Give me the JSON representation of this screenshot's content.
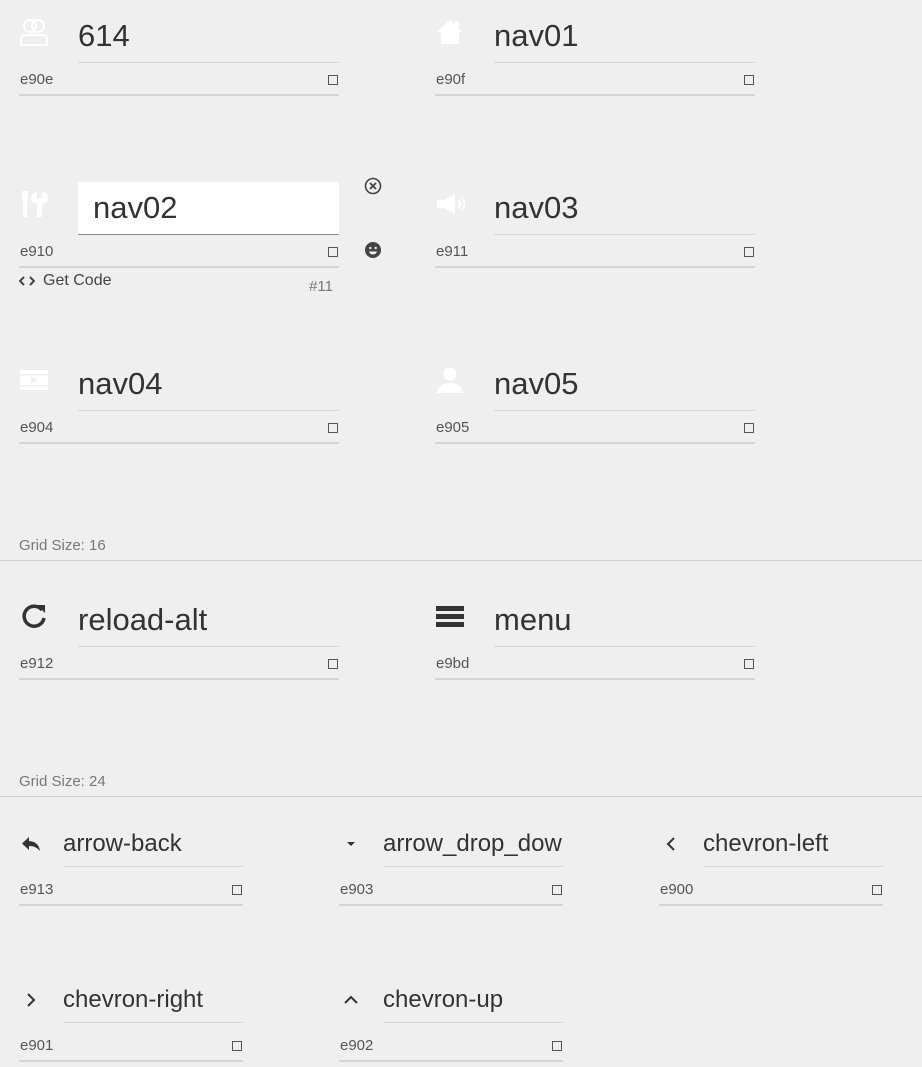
{
  "colors": {
    "background": "#efefef",
    "text": "#333333",
    "muted": "#777777",
    "icon_faint": "#ffffff",
    "icon_dark": "#333333"
  },
  "nav_glyphs": [
    {
      "name": "614",
      "code": "e90e",
      "icon": "users-icon"
    },
    {
      "name": "nav01",
      "code": "e90f",
      "icon": "home-icon"
    },
    {
      "name": "nav02",
      "code": "e910",
      "icon": "tools-icon"
    },
    {
      "name": "nav03",
      "code": "e911",
      "icon": "megaphone-icon"
    },
    {
      "name": "nav04",
      "code": "e904",
      "icon": "video-icon"
    },
    {
      "name": "nav05",
      "code": "e905",
      "icon": "person-icon"
    }
  ],
  "active_glyph": {
    "get_code_label": "Get Code",
    "index_label": "#11",
    "side_buttons": [
      "close-circle-icon",
      "smiley-icon"
    ]
  },
  "sections": [
    {
      "title": "Grid Size: 16"
    },
    {
      "title": "Grid Size: 24"
    }
  ],
  "grid16_glyphs": [
    {
      "name": "reload-alt",
      "code": "e912",
      "icon": "reload-icon"
    },
    {
      "name": "menu",
      "code": "e9bd",
      "icon": "menu-icon"
    }
  ],
  "grid24_glyphs": [
    {
      "name": "arrow-back",
      "code": "e913",
      "icon": "arrow-back-icon"
    },
    {
      "name": "arrow_drop_down",
      "code": "e903",
      "icon": "arrow-drop-down-icon"
    },
    {
      "name": "chevron-left",
      "code": "e900",
      "icon": "chevron-left-icon"
    },
    {
      "name": "chevron-right",
      "code": "e901",
      "icon": "chevron-right-icon"
    },
    {
      "name": "chevron-up",
      "code": "e902",
      "icon": "chevron-up-icon"
    }
  ]
}
